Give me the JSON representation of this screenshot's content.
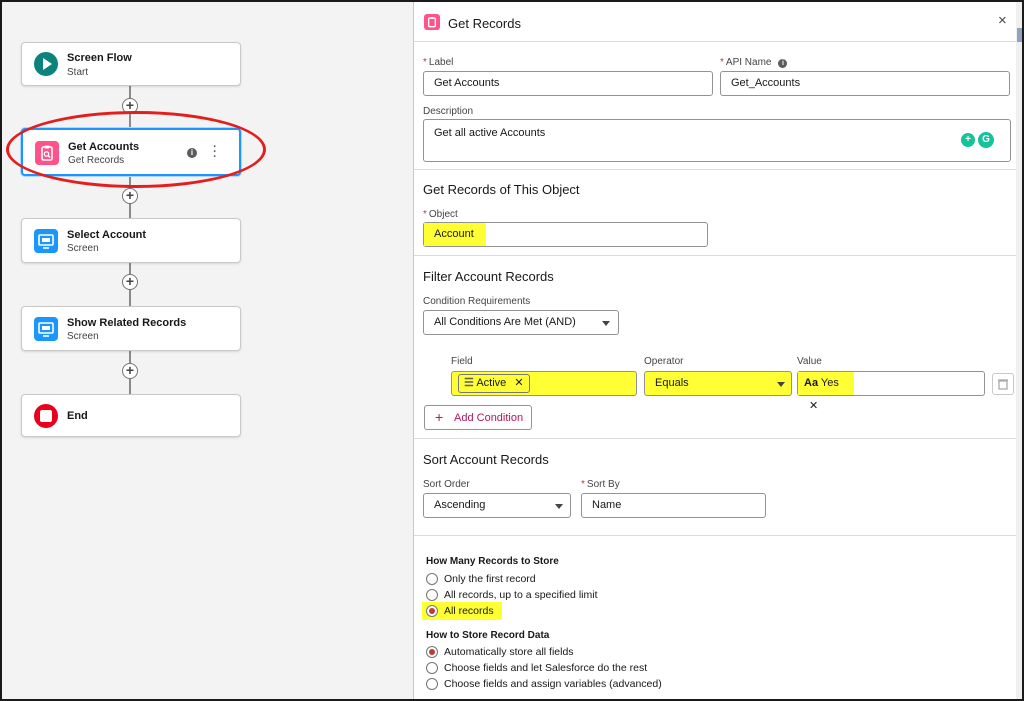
{
  "canvas": {
    "nodes": [
      {
        "title": "Screen Flow",
        "subtitle": "Start",
        "icon": "play-icon",
        "color": "#0b827c"
      },
      {
        "title": "Get Accounts",
        "subtitle": "Get Records",
        "icon": "get-records-icon",
        "color": "#ff538a"
      },
      {
        "title": "Select Account",
        "subtitle": "Screen",
        "icon": "screen-icon",
        "color": "#1b96ff"
      },
      {
        "title": "Show Related Records",
        "subtitle": "Screen",
        "icon": "screen-icon",
        "color": "#1b96ff"
      },
      {
        "title": "End",
        "subtitle": "",
        "icon": "stop-icon",
        "color": "#ea001e"
      }
    ],
    "add_symbol": "+"
  },
  "panel": {
    "title": "Get Records",
    "close_symbol": "×",
    "label_field": {
      "label": "Label",
      "value": "Get Accounts"
    },
    "api_field": {
      "label": "API Name",
      "value": "Get_Accounts"
    },
    "description": {
      "label": "Description",
      "value": "Get all active Accounts"
    },
    "object_section": {
      "title": "Get Records of This Object",
      "label": "Object",
      "value": "Account"
    },
    "filter_section": {
      "title": "Filter Account Records",
      "cond_label": "Condition Requirements",
      "cond_value": "All Conditions Are Met (AND)",
      "field_header": "Field",
      "operator_header": "Operator",
      "value_header": "Value",
      "field_value": "Active",
      "operator_value": "Equals",
      "value_value": "Yes",
      "add_condition": "Add Condition"
    },
    "sort_section": {
      "title": "Sort Account Records",
      "order_label": "Sort Order",
      "order_value": "Ascending",
      "by_label": "Sort By",
      "by_value": "Name"
    },
    "store": {
      "title": "How Many Records to Store",
      "options": [
        "Only the first record",
        "All records, up to a specified limit",
        "All records"
      ],
      "selected": 2,
      "data_title": "How to Store Record Data",
      "data_options": [
        "Automatically store all fields",
        "Choose fields and let Salesforce do the rest",
        "Choose fields and assign variables (advanced)"
      ],
      "data_selected": 0
    }
  },
  "colors": {
    "highlight": "#ffff33",
    "required": "#c23934",
    "selection": "#1b96ff",
    "annotation": "#e41d1d"
  }
}
